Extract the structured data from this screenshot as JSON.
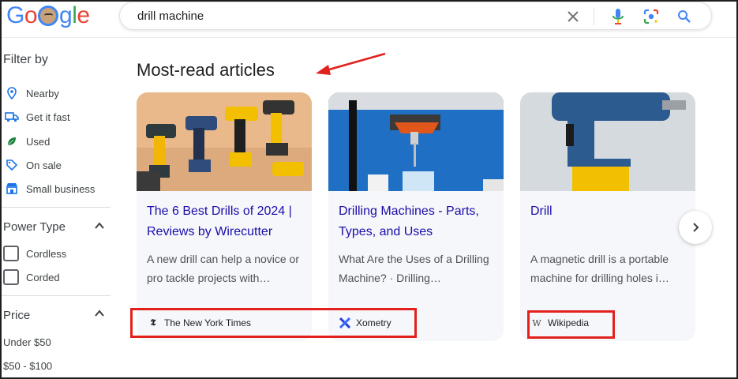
{
  "header": {
    "logo_letters": [
      "G",
      "o",
      "g",
      "l",
      "e"
    ],
    "logo_colors": [
      "#4285f4",
      "#ea4335",
      "#fbbc05",
      "#4285f4",
      "#34a853",
      "#ea4335"
    ],
    "search": {
      "query": "drill machine"
    },
    "icons": [
      "clear-icon",
      "microphone-icon",
      "lens-icon",
      "search-icon"
    ]
  },
  "sidebar": {
    "filter_title": "Filter by",
    "filters": [
      {
        "label": "Nearby",
        "icon": "location-pin-icon"
      },
      {
        "label": "Get it fast",
        "icon": "truck-icon"
      },
      {
        "label": "Used",
        "icon": "leaf-icon"
      },
      {
        "label": "On sale",
        "icon": "tag-icon"
      },
      {
        "label": "Small business",
        "icon": "storefront-icon"
      }
    ],
    "power_type": {
      "title": "Power Type",
      "options": [
        "Cordless",
        "Corded"
      ]
    },
    "price": {
      "title": "Price",
      "options": [
        "Under $50",
        "$50 - $100"
      ]
    }
  },
  "main": {
    "section_title": "Most-read articles",
    "cards": [
      {
        "title": "The 6 Best Drills of 2024 | Reviews by Wirecutter",
        "snippet": "A new drill can help a novice or pro tackle projects with…",
        "source": "The New York Times",
        "source_icon": "nyt-icon"
      },
      {
        "title": "Drilling Machines - Parts, Types, and Uses",
        "snippet": "What Are the Uses of a Drilling Machine? · Drilling…",
        "source": "Xometry",
        "source_icon": "xometry-icon"
      },
      {
        "title": "Drill",
        "snippet": "A magnetic drill is a portable machine for drilling holes i…",
        "source": "Wikipedia",
        "source_icon": "wikipedia-icon"
      }
    ],
    "next_button": "chevron-right-icon"
  },
  "colors": {
    "link": "#1a0dab",
    "annotation_red": "#e2211c",
    "card_bg": "#f6f7fa"
  }
}
